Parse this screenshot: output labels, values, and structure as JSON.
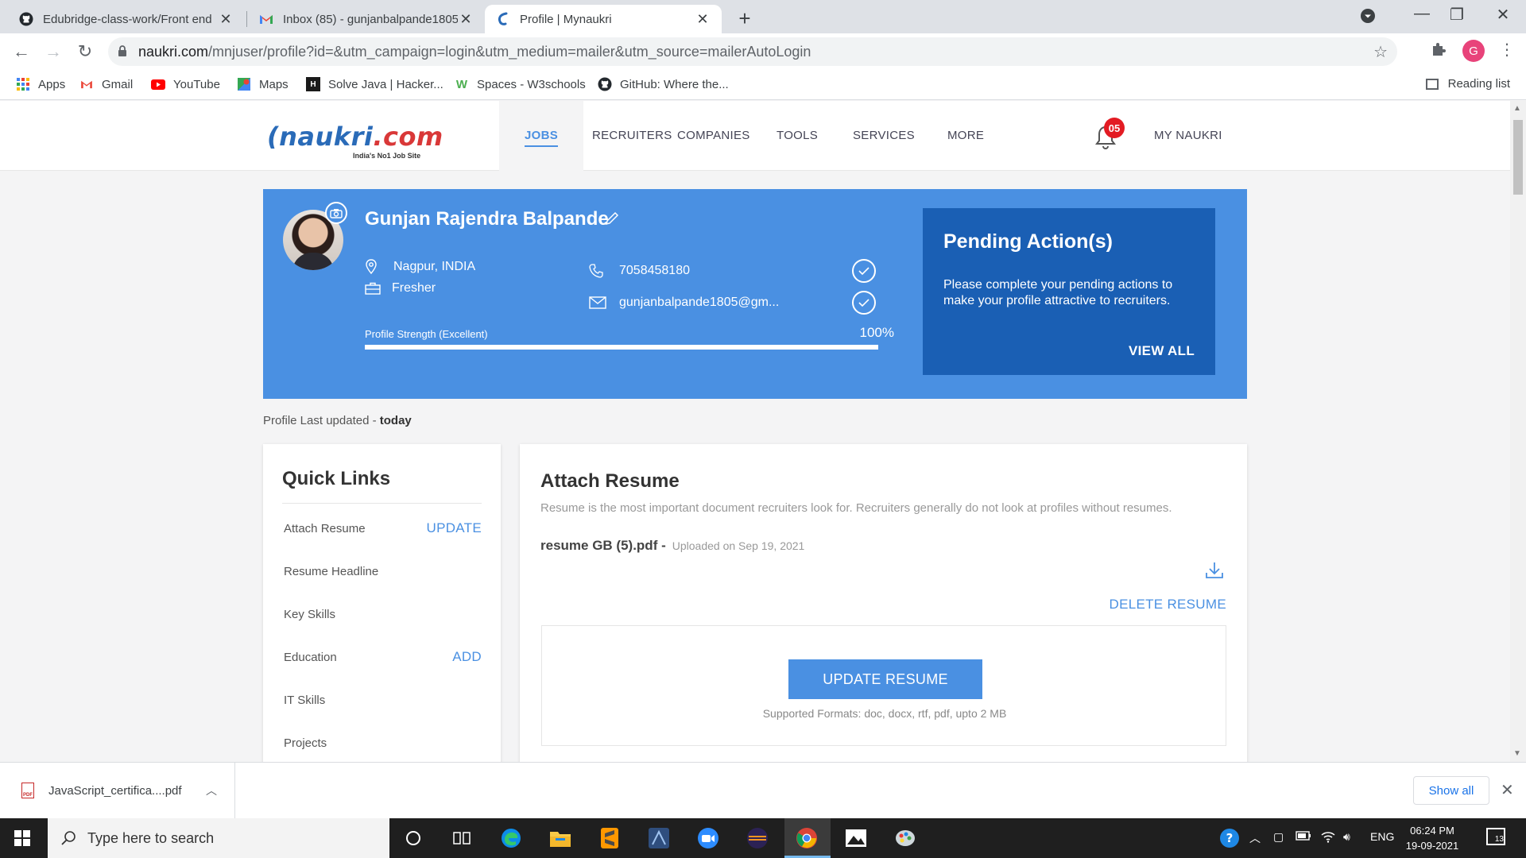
{
  "browser": {
    "tabs": [
      {
        "title": "Edubridge-class-work/Front end",
        "icon": "github-icon"
      },
      {
        "title": "Inbox (85) - gunjanbalpande1805",
        "icon": "gmail-icon"
      },
      {
        "title": "Profile | Mynaukri",
        "icon": "naukri-icon"
      }
    ],
    "url_host": "naukri.com",
    "url_path": "/mnjuser/profile?id=&utm_campaign=login&utm_medium=mailer&utm_source=mailerAutoLogin",
    "profile_initial": "G",
    "bookmarks": [
      "Apps",
      "Gmail",
      "YouTube",
      "Maps",
      "Solve Java | Hacker...",
      "Spaces - W3schools",
      "GitHub: Where the..."
    ],
    "reading_list": "Reading list"
  },
  "site": {
    "logo_text": "naukri",
    "logo_dot": ".com",
    "logo_tagline": "India's No1 Job Site",
    "nav": [
      "JOBS",
      "RECRUITERS",
      "COMPANIES",
      "TOOLS",
      "SERVICES",
      "MORE"
    ],
    "notification_count": "05",
    "my_naukri": "MY NAUKRI"
  },
  "profile": {
    "name": "Gunjan Rajendra Balpande",
    "location": "Nagpur, INDIA",
    "experience": "Fresher",
    "phone": "7058458180",
    "email": "gunjanbalpande1805@gm...",
    "strength_label": "Profile Strength (Excellent)",
    "strength_pct": "100%",
    "strength_value": 1.0,
    "pending_title": "Pending Action(s)",
    "pending_text": "Please complete your pending actions to make your profile attractive to recruiters.",
    "view_all": "VIEW ALL",
    "last_updated_label": "Profile Last updated - ",
    "last_updated_value": "today"
  },
  "quick_links": {
    "title": "Quick Links",
    "items": [
      {
        "label": "Attach Resume",
        "action": "UPDATE"
      },
      {
        "label": "Resume Headline",
        "action": ""
      },
      {
        "label": "Key Skills",
        "action": ""
      },
      {
        "label": "Education",
        "action": "ADD"
      },
      {
        "label": "IT Skills",
        "action": ""
      },
      {
        "label": "Projects",
        "action": ""
      }
    ]
  },
  "resume": {
    "title": "Attach Resume",
    "description": "Resume is the most important document recruiters look for. Recruiters generally do not look at profiles without resumes.",
    "filename": "resume GB (5).pdf -",
    "uploaded": "Uploaded on Sep 19, 2021",
    "delete": "DELETE RESUME",
    "update_button": "UPDATE RESUME",
    "formats": "Supported Formats: doc, docx, rtf, pdf, upto 2 MB"
  },
  "downloads": {
    "file": "JavaScript_certifica....pdf",
    "show_all": "Show all"
  },
  "taskbar": {
    "search_placeholder": "Type here to search",
    "language": "ENG",
    "time": "06:24 PM",
    "date": "19-09-2021",
    "notifications": "13"
  },
  "colors": {
    "accent": "#4a90e2",
    "pending_bg": "#1a5fb4",
    "badge": "#e31b23"
  }
}
